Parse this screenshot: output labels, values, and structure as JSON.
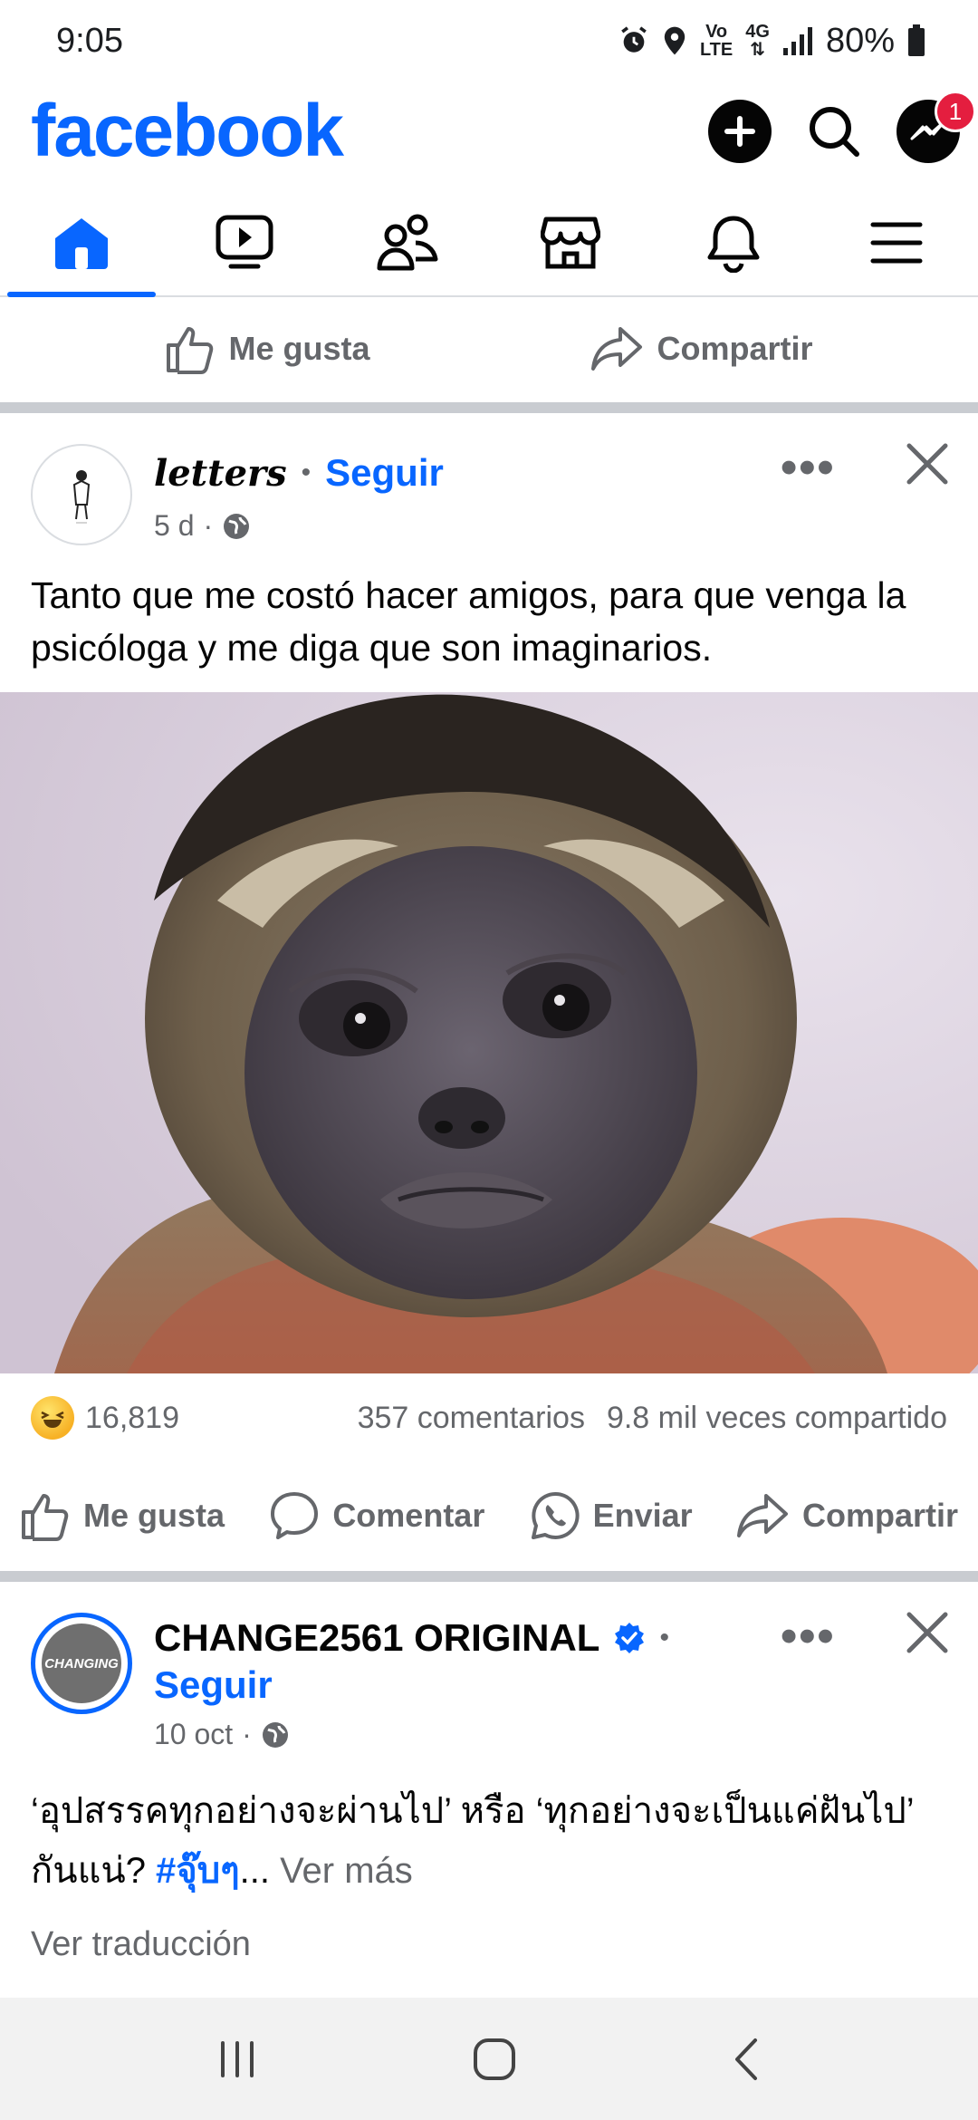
{
  "status_bar": {
    "time": "9:05",
    "lte_top": "Vo",
    "lte_bottom": "LTE",
    "network": "4G",
    "battery": "80%"
  },
  "header": {
    "logo": "facebook",
    "messenger_badge": "1"
  },
  "nav": {
    "tabs": [
      "home",
      "video",
      "friends",
      "marketplace",
      "notifications",
      "menu"
    ],
    "active": "home"
  },
  "top_actions": {
    "like": "Me gusta",
    "share": "Compartir"
  },
  "post1": {
    "author": "letters",
    "follow": "Seguir",
    "time": "5 d",
    "text": "Tanto que me costó hacer amigos, para que venga la psicóloga y me diga que son imaginarios.",
    "reactions_count": "16,819",
    "comments": "357 comentarios",
    "shares": "9.8 mil veces compartido",
    "actions": {
      "like": "Me gusta",
      "comment": "Comentar",
      "send": "Enviar",
      "share": "Compartir"
    }
  },
  "post2": {
    "author": "CHANGE2561 ORIGINAL",
    "avatar_text": "CHANGING",
    "follow": "Seguir",
    "time": "10 oct",
    "text": "‘อุปสรรคทุกอย่างจะผ่านไป’ หรือ ‘ทุกอย่างจะเป็นแค่ฝันไป’ กันแน่? ",
    "hashtag": "#จุ๊บๆ",
    "ellipsis": "...",
    "see_more": "Ver más",
    "translate": "Ver traducción"
  },
  "colors": {
    "brand": "#0866ff",
    "badge": "#e41e3f",
    "muted": "#65676b",
    "separator": "#c9ccd1"
  }
}
